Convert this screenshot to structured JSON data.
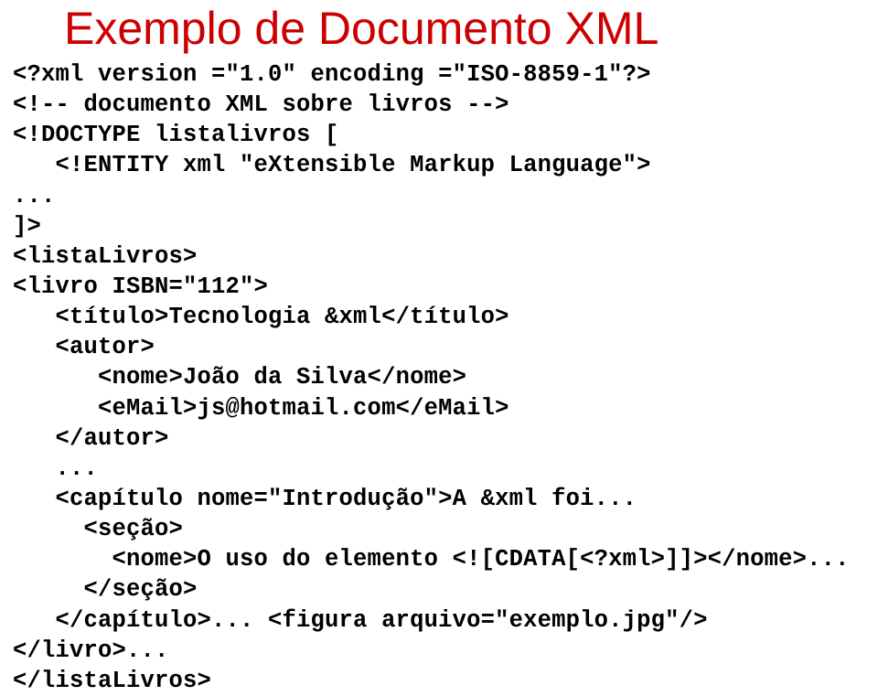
{
  "title": "Exemplo de Documento XML",
  "code": {
    "l01": "<?xml version =\"1.0\" encoding =\"ISO-8859-1\"?>",
    "l02": "<!-- documento XML sobre livros -->",
    "l03": "<!DOCTYPE listalivros [",
    "l04": "   <!ENTITY xml \"eXtensible Markup Language\">",
    "l05": "...",
    "l06": "]>",
    "l07": "<listaLivros>",
    "l08": "<livro ISBN=\"112\">",
    "l09": "   <título>Tecnologia &xml</título>",
    "l10": "   <autor>",
    "l11": "      <nome>João da Silva</nome>",
    "l12": "      <eMail>js@hotmail.com</eMail>",
    "l13": "   </autor>",
    "l14": "   ...",
    "l15": "   <capítulo nome=\"Introdução\">A &xml foi...",
    "l16": "     <seção>",
    "l17": "       <nome>O uso do elemento <![CDATA[<?xml>]]></nome>...",
    "l18": "     </seção>",
    "l19": "   </capítulo>... <figura arquivo=\"exemplo.jpg\"/>",
    "l20": "</livro>...",
    "l21": "</listaLivros>"
  }
}
